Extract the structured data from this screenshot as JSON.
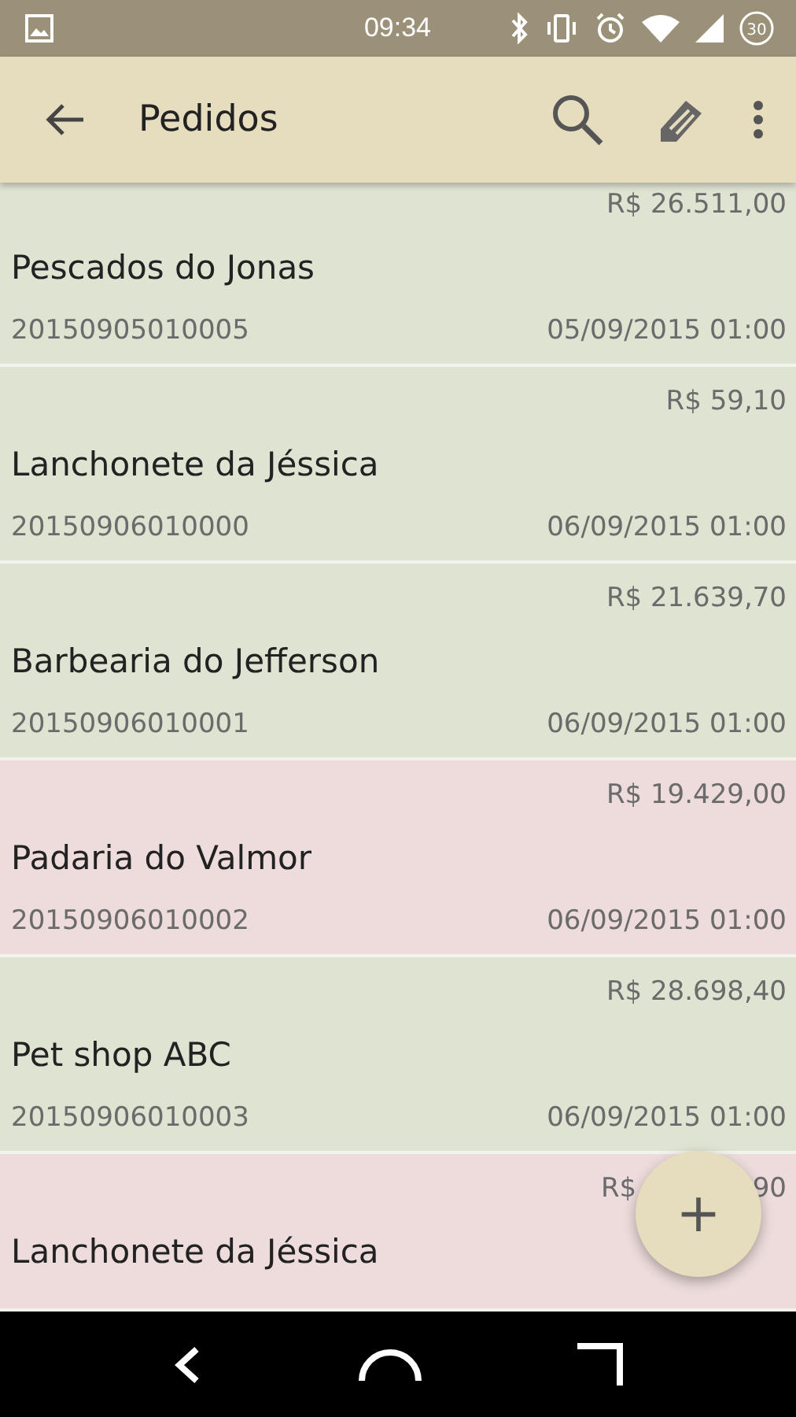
{
  "status_bar": {
    "time": "09:34",
    "battery": "30"
  },
  "toolbar": {
    "title": "Pedidos"
  },
  "orders": [
    {
      "amount": "R$ 26.511,00",
      "customer": "Pescados do Jonas",
      "code": "20150905010005",
      "date": "05/09/2015 01:00",
      "color": "#dfe3d2"
    },
    {
      "amount": "R$ 59,10",
      "customer": "Lanchonete da Jéssica",
      "code": "20150906010000",
      "date": "06/09/2015 01:00",
      "color": "#dfe3d2"
    },
    {
      "amount": "R$ 21.639,70",
      "customer": "Barbearia do Jefferson",
      "code": "20150906010001",
      "date": "06/09/2015 01:00",
      "color": "#dfe3d2"
    },
    {
      "amount": "R$ 19.429,00",
      "customer": "Padaria do Valmor",
      "code": "20150906010002",
      "date": "06/09/2015 01:00",
      "color": "#eedcdc"
    },
    {
      "amount": "R$ 28.698,40",
      "customer": "Pet shop ABC",
      "code": "20150906010003",
      "date": "06/09/2015 01:00",
      "color": "#dfe3d2"
    },
    {
      "amount_parts": [
        "R$",
        "90"
      ],
      "customer": "Lanchonete da Jéssica",
      "color": "#eedcdc"
    }
  ],
  "fab": {
    "label": "+"
  }
}
